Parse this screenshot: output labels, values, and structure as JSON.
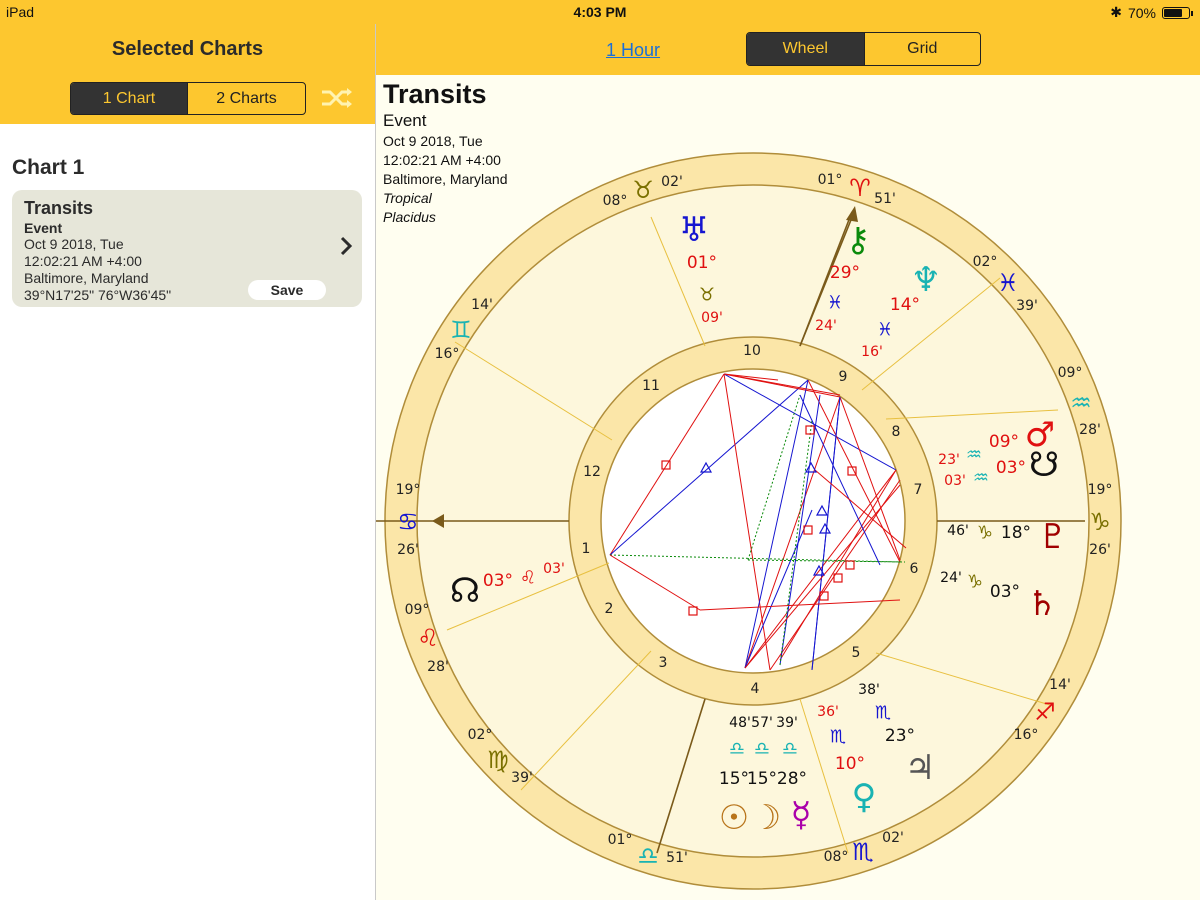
{
  "status": {
    "device": "iPad",
    "time": "4:03 PM",
    "battery": "70%"
  },
  "sidebar": {
    "title": "Selected Charts",
    "segments": [
      "1 Chart",
      "2 Charts"
    ],
    "chart_label": "Chart 1",
    "card": {
      "title": "Transits",
      "subtitle": "Event",
      "date": "Oct 9 2018, Tue",
      "time": "12:02:21 AM +4:00",
      "place": "Baltimore, Maryland",
      "coords": "39°N17'25\" 76°W36'45\"",
      "save": "Save"
    }
  },
  "header": {
    "one_hour": "1 Hour",
    "view_tabs": [
      "Wheel",
      "Grid"
    ]
  },
  "info": {
    "title": "Transits",
    "type": "Event",
    "date": "Oct 9 2018, Tue",
    "time": "12:02:21 AM +4:00",
    "place": "Baltimore, Maryland",
    "zodiac": "Tropical",
    "houses": "Placidus"
  },
  "colors": {
    "accent": "#fdc72f",
    "ring": "#fbe6a8",
    "red": "#e01010",
    "blue": "#1515d0",
    "green": "#0a8a0a",
    "olive": "#7a7000"
  },
  "wheel": {
    "houses": [
      "1",
      "2",
      "3",
      "4",
      "5",
      "6",
      "7",
      "8",
      "9",
      "10",
      "11",
      "12"
    ],
    "cusps": [
      {
        "deg": "19°",
        "sign": "♋",
        "min": "26'",
        "color": "#1515d0"
      },
      {
        "deg": "09°",
        "sign": "♌",
        "min": "28'",
        "color": "#e01010"
      },
      {
        "deg": "02°",
        "sign": "♍",
        "min": "39'",
        "color": "#7a7000"
      },
      {
        "deg": "01°",
        "sign": "♎",
        "min": "51'",
        "color": "#19b3b3"
      },
      {
        "deg": "08°",
        "sign": "♏",
        "min": "02'",
        "color": "#1515d0"
      },
      {
        "deg": "16°",
        "sign": "♐",
        "min": "14'",
        "color": "#e01010"
      },
      {
        "deg": "19°",
        "sign": "♑",
        "min": "26'",
        "color": "#7a7000"
      },
      {
        "deg": "09°",
        "sign": "♒",
        "min": "28'",
        "color": "#19b3b3"
      },
      {
        "deg": "02°",
        "sign": "♓",
        "min": "39'",
        "color": "#1515d0"
      },
      {
        "deg": "01°",
        "sign": "♈",
        "min": "51'",
        "color": "#e01010"
      },
      {
        "deg": "08°",
        "sign": "♉",
        "min": "02'",
        "color": "#7a7000"
      },
      {
        "deg": "16°",
        "sign": "♊",
        "min": "14'",
        "color": "#19b3b3"
      }
    ],
    "planets": [
      {
        "name": "Uranus",
        "glyph": "♅",
        "deg": "01°",
        "sign": "♉",
        "min": "09'",
        "color": "#1515d0"
      },
      {
        "name": "Chiron",
        "glyph": "⚷",
        "deg": "29°",
        "sign": "♓",
        "min": "24'",
        "color": "#0a8a0a"
      },
      {
        "name": "Neptune",
        "glyph": "♆",
        "deg": "14°",
        "sign": "♓",
        "min": "16'",
        "color": "#19b3b3"
      },
      {
        "name": "Mars",
        "glyph": "♂",
        "deg": "09°",
        "sign": "♒",
        "min": "23'",
        "color": "#e01010"
      },
      {
        "name": "South Node",
        "glyph": "☋",
        "deg": "03°",
        "sign": "♒",
        "min": "03'",
        "color": "#111111"
      },
      {
        "name": "Pluto",
        "glyph": "♇",
        "deg": "18°",
        "sign": "♑",
        "min": "46'",
        "color": "#a00000"
      },
      {
        "name": "Saturn",
        "glyph": "♄",
        "deg": "03°",
        "sign": "♑",
        "min": "24'",
        "color": "#a00000"
      },
      {
        "name": "Jupiter",
        "glyph": "♃",
        "deg": "23°",
        "sign": "♏",
        "min": "38'",
        "color": "#555555"
      },
      {
        "name": "Venus",
        "glyph": "♀",
        "deg": "10°",
        "sign": "♏",
        "min": "36'",
        "color": "#19b3b3"
      },
      {
        "name": "Mercury",
        "glyph": "☿",
        "deg": "28°",
        "sign": "♎",
        "min": "39'",
        "color": "#aa00aa"
      },
      {
        "name": "Moon",
        "glyph": "☽",
        "deg": "15°",
        "sign": "♎",
        "min": "57'",
        "color": "#b8741a"
      },
      {
        "name": "Sun",
        "glyph": "☉",
        "deg": "15°",
        "sign": "♎",
        "min": "48'",
        "color": "#b8741a"
      },
      {
        "name": "North Node",
        "glyph": "☊",
        "deg": "03°",
        "sign": "♌",
        "min": "03'",
        "color": "#111111"
      }
    ]
  }
}
